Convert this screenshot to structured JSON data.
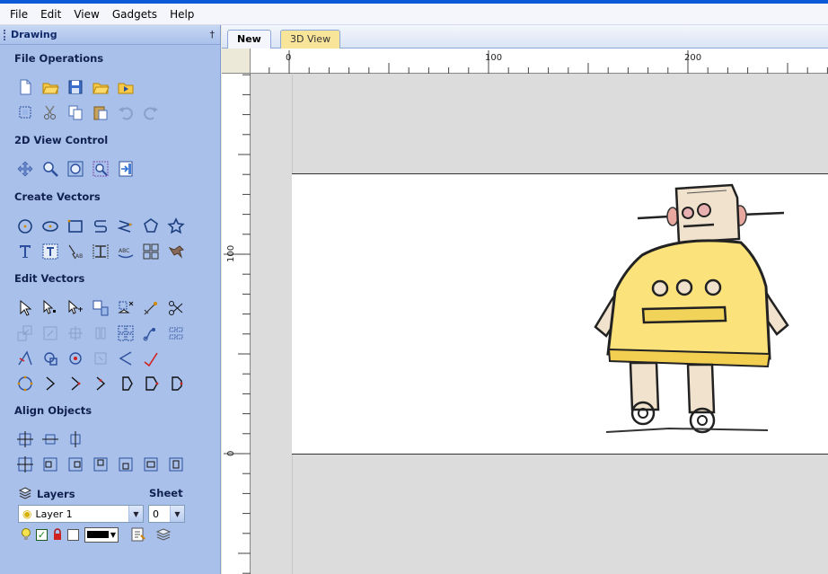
{
  "menu": [
    "File",
    "Edit",
    "View",
    "Gadgets",
    "Help"
  ],
  "panel": {
    "title": "Drawing",
    "pin": "†"
  },
  "sections": {
    "file_operations": "File Operations",
    "view_control": "2D View Control",
    "create_vectors": "Create Vectors",
    "edit_vectors": "Edit Vectors",
    "align_objects": "Align Objects"
  },
  "layers": {
    "label": "Layers",
    "sheet_label": "Sheet",
    "current_layer": "Layer 1",
    "current_sheet": "0"
  },
  "tabs": [
    {
      "label": "New",
      "active": true
    },
    {
      "label": "3D View",
      "active": false
    }
  ],
  "ruler": {
    "h_labels": [
      "0",
      "100",
      "200"
    ],
    "v_labels": [
      "100",
      "0"
    ]
  }
}
